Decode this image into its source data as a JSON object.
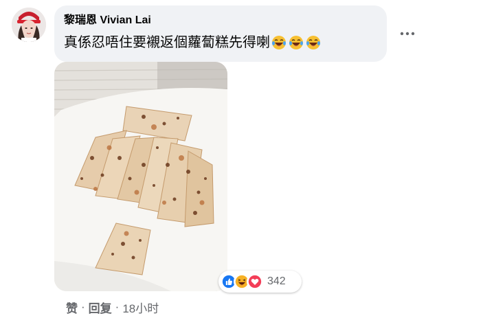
{
  "comment": {
    "author": "黎瑞恩 Vivian Lai",
    "text": "真係忍唔住要襯返個蘿蔔糕先得喇",
    "emoji_icons": [
      "laughing-tears-emoji",
      "laughing-tears-emoji",
      "laughing-tears-emoji"
    ],
    "photo_subject": "turnip-cake-photo",
    "reactions": {
      "icons": [
        "like-icon",
        "haha-icon",
        "love-icon"
      ],
      "count": "342"
    },
    "actions": {
      "like": "赞",
      "reply": "回复",
      "separator": "·",
      "time": "18小时"
    }
  },
  "colors": {
    "bubble": "#f0f2f5",
    "meta_text": "#65676b",
    "like_blue": "#1877f2",
    "love_red": "#f33e58",
    "haha_yellow": "#f7b125"
  }
}
